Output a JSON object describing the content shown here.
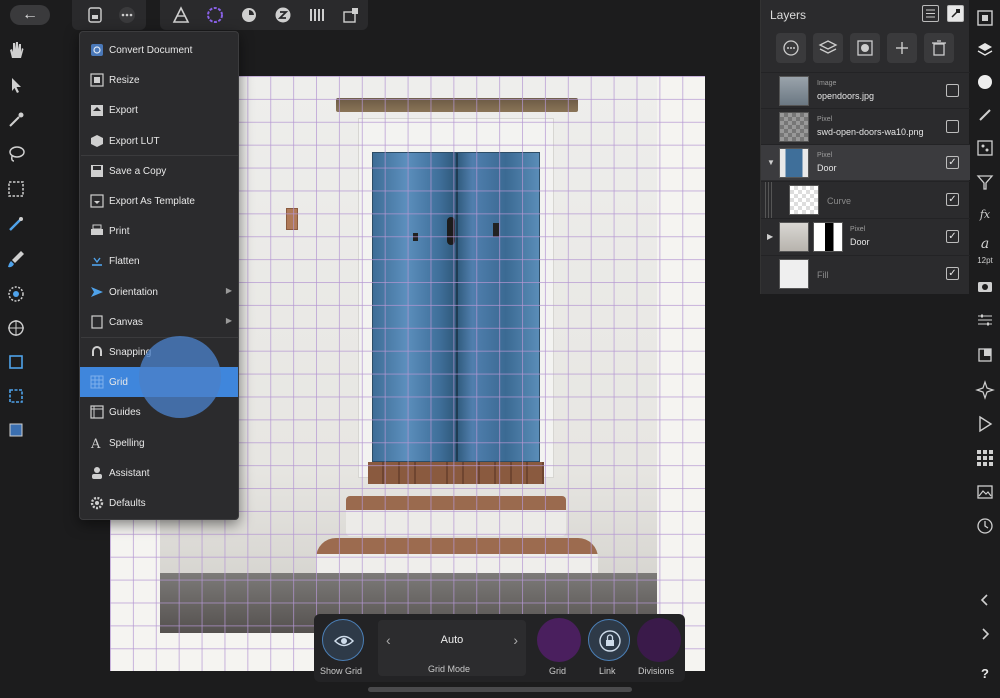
{
  "top_toolbar": {
    "back_arrow": "←",
    "icons": [
      "document-icon",
      "more-icon",
      "photo-persona-icon",
      "liquify-persona-icon",
      "develop-persona-icon",
      "tone-mapping-persona-icon",
      "export-persona-icon",
      "share-icon"
    ]
  },
  "document_menu": {
    "items": [
      {
        "label": "Convert Document",
        "icon": "convert-document-icon"
      },
      {
        "label": "Resize",
        "icon": "resize-icon"
      },
      {
        "label": "Export",
        "icon": "export-icon"
      },
      {
        "label": "Export LUT",
        "icon": "export-lut-icon"
      },
      {
        "label": "Save a Copy",
        "icon": "save-copy-icon"
      },
      {
        "label": "Export As Template",
        "icon": "export-template-icon"
      },
      {
        "label": "Print",
        "icon": "print-icon"
      },
      {
        "label": "Flatten",
        "icon": "flatten-icon"
      },
      {
        "label": "Orientation",
        "icon": "orientation-icon",
        "submenu": true
      },
      {
        "label": "Canvas",
        "icon": "canvas-icon",
        "submenu": true
      },
      {
        "label": "Snapping",
        "icon": "snapping-icon"
      },
      {
        "label": "Grid",
        "icon": "grid-icon",
        "active": true
      },
      {
        "label": "Guides",
        "icon": "guides-icon"
      },
      {
        "label": "Spelling",
        "icon": "spelling-icon"
      },
      {
        "label": "Assistant",
        "icon": "assistant-icon"
      },
      {
        "label": "Defaults",
        "icon": "defaults-icon"
      }
    ],
    "submenu_arrow": "▶"
  },
  "layers_panel": {
    "title": "Layers",
    "layers": [
      {
        "type": "Image",
        "name": "opendoors.jpg",
        "checked": false,
        "selected": false
      },
      {
        "type": "Pixel",
        "name": "swd-open-doors-wa10.png",
        "checked": false,
        "selected": false
      },
      {
        "type": "Pixel",
        "name": "Door",
        "checked": true,
        "selected": true,
        "expanded": true
      },
      {
        "type": "",
        "name": "Curve",
        "checked": true,
        "selected": false,
        "child": true
      },
      {
        "type": "Pixel",
        "name": "Door",
        "checked": true,
        "selected": false,
        "masked": true
      },
      {
        "type": "",
        "name": "Fill",
        "checked": true,
        "selected": false
      }
    ],
    "check_mark": "✓",
    "expanded_arrow": "▼",
    "collapsed_arrow": "▶"
  },
  "right_strip": {
    "font_size_label": "12pt",
    "help_label": "?"
  },
  "grid_bar": {
    "show_grid_label": "Show Grid",
    "grid_mode_label": "Grid Mode",
    "grid_mode_value": "Auto",
    "grid_label": "Grid",
    "link_label": "Link",
    "divisions_label": "Divisions",
    "grid_color": "#4a1f5e",
    "divisions_color": "#3a1a4a"
  },
  "colors": {
    "accent": "#3f86dc",
    "panel": "#2b2b2d",
    "background": "#1c1c1d",
    "grid_line": "#b496d2"
  }
}
